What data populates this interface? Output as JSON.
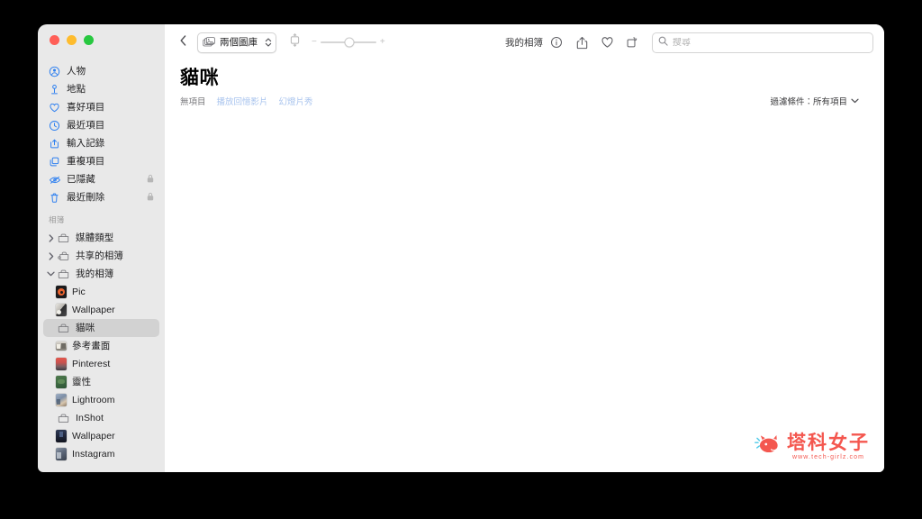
{
  "window": {
    "traffic_lights": [
      "close",
      "minimize",
      "zoom"
    ],
    "colors": {
      "close": "#ff5f57",
      "minimize": "#febc2e",
      "zoom": "#28c840",
      "sidebar_bg": "#e9e9e9",
      "selected_row": "#d2d2d2",
      "accent_blue": "#2d7ff0",
      "link_blue": "#a9c4ee",
      "watermark": "#f4574f"
    }
  },
  "toolbar": {
    "back_icon": "chevron-left-icon",
    "library_popup": {
      "icon": "photos-library-icon",
      "label": "兩個圖庫",
      "chevron": "chevron-up-down-icon"
    },
    "fit_icon": "aspect-fit-icon",
    "zoom_slider": {
      "minus": "−",
      "plus": "+",
      "value_percent": 52
    },
    "center_label": "我的相簿",
    "icons": [
      {
        "name": "info-icon",
        "glyph": "info"
      },
      {
        "name": "share-icon",
        "glyph": "share"
      },
      {
        "name": "favorite-heart-icon",
        "glyph": "heart"
      },
      {
        "name": "rotate-icon",
        "glyph": "rotate"
      }
    ],
    "search": {
      "icon": "search-icon",
      "placeholder": "搜尋",
      "value": ""
    }
  },
  "header": {
    "title": "貓咪",
    "item_count_label": "無項目",
    "links": [
      {
        "label": "播放回憶影片",
        "name": "play-memory-movie-link"
      },
      {
        "label": "幻燈片秀",
        "name": "slideshow-link"
      }
    ],
    "filter": {
      "label": "過濾條件：所有項目",
      "chevron": "chevron-down-icon"
    }
  },
  "sidebar": {
    "top_items": [
      {
        "label": "人物",
        "icon": "people-icon",
        "locked": false
      },
      {
        "label": "地點",
        "icon": "map-pin-icon",
        "locked": false
      },
      {
        "label": "喜好項目",
        "icon": "heart-icon",
        "locked": false
      },
      {
        "label": "最近項目",
        "icon": "clock-icon",
        "locked": false
      },
      {
        "label": "輸入記錄",
        "icon": "import-icon",
        "locked": false
      },
      {
        "label": "重複項目",
        "icon": "duplicate-icon",
        "locked": false
      },
      {
        "label": "已隱藏",
        "icon": "eye-slash-icon",
        "locked": true
      },
      {
        "label": "最近刪除",
        "icon": "trash-icon",
        "locked": true
      }
    ],
    "section_title": "相簿",
    "groups": [
      {
        "label": "媒體類型",
        "icon": "folder-icon",
        "expanded": false
      },
      {
        "label": "共享的相簿",
        "icon": "shared-folder-icon",
        "expanded": false
      },
      {
        "label": "我的相簿",
        "icon": "folder-icon",
        "expanded": true
      }
    ],
    "albums": [
      {
        "label": "Pic",
        "icon": "album-thumbnail-pic",
        "selected": false
      },
      {
        "label": "Wallpaper",
        "icon": "album-thumbnail-wallpaper",
        "selected": false
      },
      {
        "label": "貓咪",
        "icon": "album-folder-icon",
        "selected": true
      },
      {
        "label": "參考畫面",
        "icon": "album-thumbnail-reference",
        "selected": false
      },
      {
        "label": "Pinterest",
        "icon": "album-thumbnail-pinterest",
        "selected": false
      },
      {
        "label": "靈性",
        "icon": "album-thumbnail-spirit",
        "selected": false
      },
      {
        "label": "Lightroom",
        "icon": "album-thumbnail-lightroom",
        "selected": false
      },
      {
        "label": "InShot",
        "icon": "album-folder-icon",
        "selected": false
      },
      {
        "label": "Wallpaper",
        "icon": "album-thumbnail-wallpaper2",
        "selected": false
      },
      {
        "label": "Instagram",
        "icon": "album-thumbnail-instagram",
        "selected": false
      }
    ]
  },
  "watermark": {
    "title": "塔科女子",
    "url": "www.tech-girlz.com",
    "icon": "cat-logo-icon"
  }
}
